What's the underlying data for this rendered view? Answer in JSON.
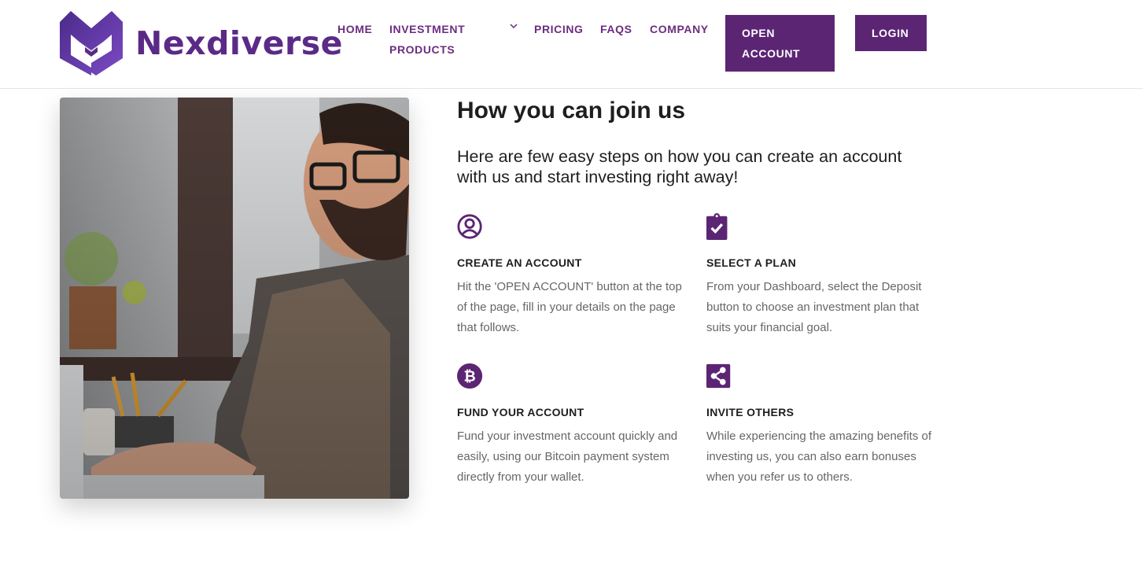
{
  "brand": {
    "name": "Nexdiverse",
    "color": "#5b2a86"
  },
  "nav": {
    "home": "HOME",
    "investment_products": "INVESTMENT PRODUCTS",
    "pricing": "PRICING",
    "faqs": "FAQS",
    "company": "COMPANY"
  },
  "buttons": {
    "open_account": "OPEN ACCOUNT",
    "login": "LOGIN"
  },
  "section": {
    "title": "How you can join us",
    "intro": "Here are few easy steps on how you can create an account with us and start investing right away!"
  },
  "steps": [
    {
      "icon": "user-circle-icon",
      "title": "CREATE AN ACCOUNT",
      "desc": "Hit the 'OPEN ACCOUNT' button at the top of the page, fill in your details on the page that follows."
    },
    {
      "icon": "clipboard-check-icon",
      "title": "SELECT A PLAN",
      "desc": "From your Dashboard, select the Deposit button to choose an investment plan that suits your financial goal."
    },
    {
      "icon": "bitcoin-icon",
      "title": "FUND YOUR ACCOUNT",
      "desc": "Fund your investment account quickly and easily, using our Bitcoin payment system directly from your wallet."
    },
    {
      "icon": "share-icon",
      "title": "INVITE OTHERS",
      "desc": "While experiencing the amazing benefits of investing us, you can also earn bonuses when you refer us to others."
    }
  ],
  "colors": {
    "accent": "#5c2574",
    "nav_text": "#6b2d80",
    "body_text": "#666666"
  }
}
